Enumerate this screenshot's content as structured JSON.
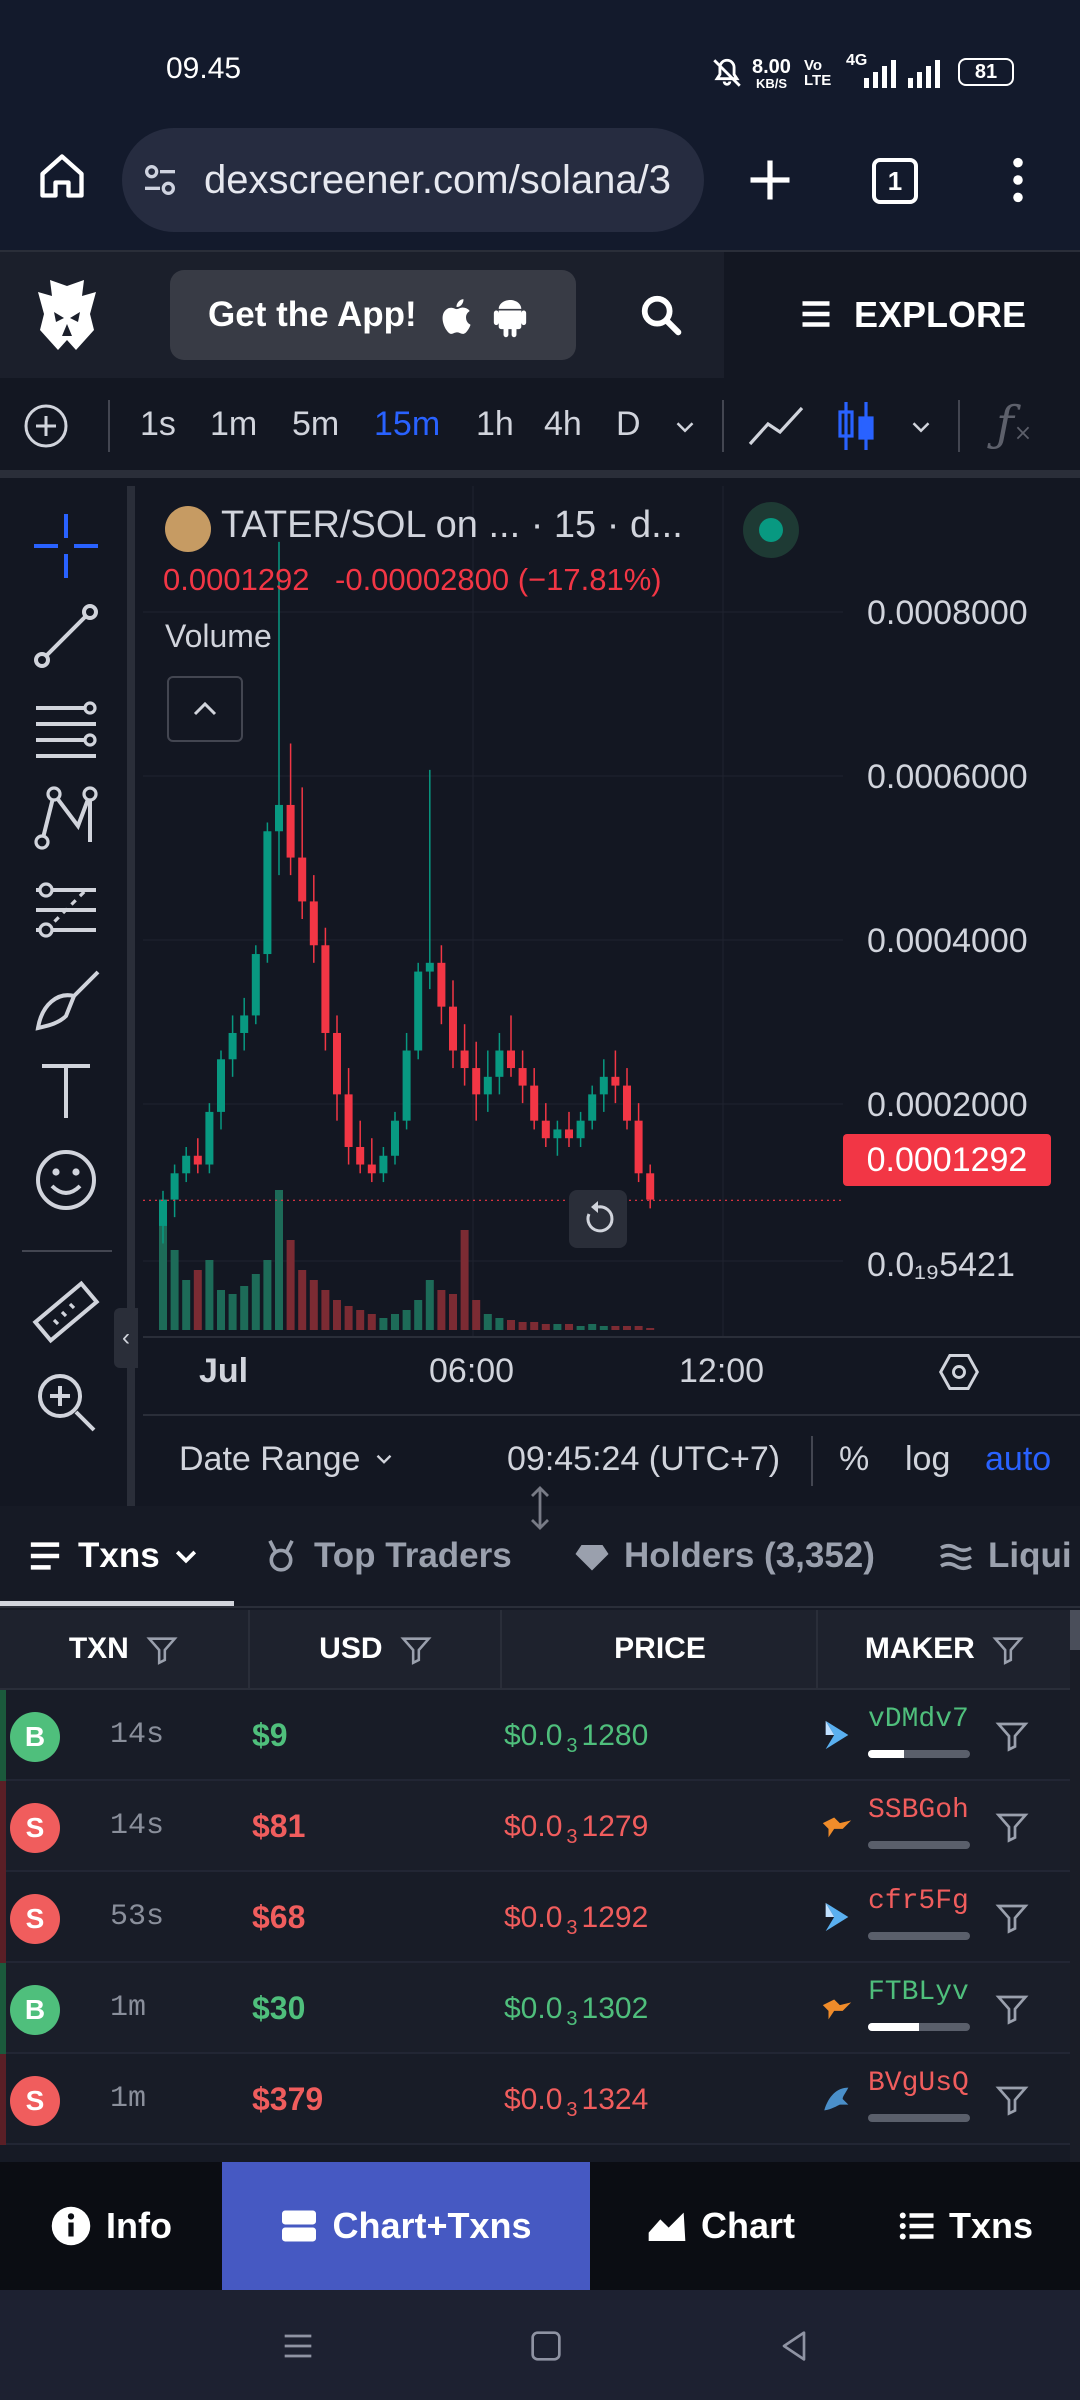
{
  "status_bar": {
    "time": "09.45",
    "net_speed": "8.00",
    "net_unit": "KB/S",
    "volte": "Vo LTE",
    "network": "4G",
    "battery": "81"
  },
  "browser": {
    "url": "dexscreener.com/solana/3",
    "tab_count": "1"
  },
  "app_header": {
    "get_app_label": "Get the App!",
    "explore_label": "EXPLORE"
  },
  "chart_toolbar": {
    "timeframes": [
      "1s",
      "1m",
      "5m",
      "15m",
      "1h",
      "4h",
      "D"
    ],
    "active_timeframe": "15m"
  },
  "chart_legend": {
    "symbol": "TATER/SOL on ... · 15 · d...",
    "last": "0.0001292",
    "change": "-0.00002800 (−17.81%)",
    "volume_label": "Volume"
  },
  "chart_data": {
    "type": "candlestick",
    "title": "TATER/SOL on ... · 15 · d...",
    "price_axis_ticks": [
      "0.0008000",
      "0.0006000",
      "0.0004000",
      "0.0002000",
      "0.0₁₉5421"
    ],
    "time_axis_ticks": [
      "Jul",
      "06:00",
      "12:00"
    ],
    "last_price_label": "0.0001292",
    "ylim": [
      0.0,
      0.0009
    ],
    "candles": [
      {
        "o": 0.0001,
        "h": 0.00014,
        "l": 8e-05,
        "c": 0.00013,
        "v": 0.55
      },
      {
        "o": 0.00013,
        "h": 0.00017,
        "l": 0.00011,
        "c": 0.00016,
        "v": 0.4
      },
      {
        "o": 0.00016,
        "h": 0.00019,
        "l": 0.00015,
        "c": 0.00018,
        "v": 0.25
      },
      {
        "o": 0.00018,
        "h": 0.0002,
        "l": 0.00016,
        "c": 0.00017,
        "v": 0.3
      },
      {
        "o": 0.00017,
        "h": 0.00024,
        "l": 0.00016,
        "c": 0.00023,
        "v": 0.35
      },
      {
        "o": 0.00023,
        "h": 0.0003,
        "l": 0.00021,
        "c": 0.00029,
        "v": 0.2
      },
      {
        "o": 0.00029,
        "h": 0.00034,
        "l": 0.00027,
        "c": 0.00032,
        "v": 0.18
      },
      {
        "o": 0.00032,
        "h": 0.00036,
        "l": 0.0003,
        "c": 0.00034,
        "v": 0.22
      },
      {
        "o": 0.00034,
        "h": 0.00042,
        "l": 0.00033,
        "c": 0.00041,
        "v": 0.28
      },
      {
        "o": 0.00041,
        "h": 0.00056,
        "l": 0.0004,
        "c": 0.00055,
        "v": 0.35
      },
      {
        "o": 0.00055,
        "h": 0.00088,
        "l": 0.0005,
        "c": 0.00058,
        "v": 0.7
      },
      {
        "o": 0.00058,
        "h": 0.00065,
        "l": 0.0005,
        "c": 0.00052,
        "v": 0.45
      },
      {
        "o": 0.00052,
        "h": 0.0006,
        "l": 0.00045,
        "c": 0.00047,
        "v": 0.3
      },
      {
        "o": 0.00047,
        "h": 0.0005,
        "l": 0.0004,
        "c": 0.00042,
        "v": 0.25
      },
      {
        "o": 0.00042,
        "h": 0.00044,
        "l": 0.0003,
        "c": 0.00032,
        "v": 0.2
      },
      {
        "o": 0.00032,
        "h": 0.00034,
        "l": 0.00022,
        "c": 0.00025,
        "v": 0.15
      },
      {
        "o": 0.00025,
        "h": 0.00028,
        "l": 0.00017,
        "c": 0.00019,
        "v": 0.12
      },
      {
        "o": 0.00019,
        "h": 0.00022,
        "l": 0.00016,
        "c": 0.00017,
        "v": 0.1
      },
      {
        "o": 0.00017,
        "h": 0.0002,
        "l": 0.00015,
        "c": 0.00016,
        "v": 0.08
      },
      {
        "o": 0.00016,
        "h": 0.00019,
        "l": 0.00015,
        "c": 0.00018,
        "v": 0.06
      },
      {
        "o": 0.00018,
        "h": 0.00023,
        "l": 0.00017,
        "c": 0.00022,
        "v": 0.08
      },
      {
        "o": 0.00022,
        "h": 0.00032,
        "l": 0.00021,
        "c": 0.0003,
        "v": 0.1
      },
      {
        "o": 0.0003,
        "h": 0.0004,
        "l": 0.00029,
        "c": 0.00039,
        "v": 0.15
      },
      {
        "o": 0.00039,
        "h": 0.00062,
        "l": 0.00037,
        "c": 0.0004,
        "v": 0.25
      },
      {
        "o": 0.0004,
        "h": 0.00042,
        "l": 0.00033,
        "c": 0.00035,
        "v": 0.2
      },
      {
        "o": 0.00035,
        "h": 0.00038,
        "l": 0.00028,
        "c": 0.0003,
        "v": 0.18
      },
      {
        "o": 0.0003,
        "h": 0.00033,
        "l": 0.00026,
        "c": 0.00028,
        "v": 0.5
      },
      {
        "o": 0.00028,
        "h": 0.00031,
        "l": 0.00022,
        "c": 0.00025,
        "v": 0.15
      },
      {
        "o": 0.00025,
        "h": 0.0003,
        "l": 0.00023,
        "c": 0.00027,
        "v": 0.08
      },
      {
        "o": 0.00027,
        "h": 0.00032,
        "l": 0.00025,
        "c": 0.0003,
        "v": 0.06
      },
      {
        "o": 0.0003,
        "h": 0.00034,
        "l": 0.00027,
        "c": 0.00028,
        "v": 0.05
      },
      {
        "o": 0.00028,
        "h": 0.0003,
        "l": 0.00024,
        "c": 0.00026,
        "v": 0.04
      },
      {
        "o": 0.00026,
        "h": 0.00028,
        "l": 0.00021,
        "c": 0.00022,
        "v": 0.04
      },
      {
        "o": 0.00022,
        "h": 0.00024,
        "l": 0.00019,
        "c": 0.0002,
        "v": 0.03
      },
      {
        "o": 0.0002,
        "h": 0.00022,
        "l": 0.00018,
        "c": 0.00021,
        "v": 0.03
      },
      {
        "o": 0.00021,
        "h": 0.00023,
        "l": 0.00019,
        "c": 0.0002,
        "v": 0.03
      },
      {
        "o": 0.0002,
        "h": 0.00023,
        "l": 0.00019,
        "c": 0.00022,
        "v": 0.02
      },
      {
        "o": 0.00022,
        "h": 0.00026,
        "l": 0.00021,
        "c": 0.00025,
        "v": 0.03
      },
      {
        "o": 0.00025,
        "h": 0.00029,
        "l": 0.00023,
        "c": 0.00027,
        "v": 0.02
      },
      {
        "o": 0.00027,
        "h": 0.0003,
        "l": 0.00024,
        "c": 0.00026,
        "v": 0.02
      },
      {
        "o": 0.00026,
        "h": 0.00028,
        "l": 0.00021,
        "c": 0.00022,
        "v": 0.02
      },
      {
        "o": 0.00022,
        "h": 0.00024,
        "l": 0.00015,
        "c": 0.00016,
        "v": 0.02
      },
      {
        "o": 0.00016,
        "h": 0.00017,
        "l": 0.00012,
        "c": 0.00013,
        "v": 0.01
      }
    ]
  },
  "chart_footer": {
    "date_range": "Date Range",
    "time": "09:45:24 (UTC+7)",
    "percent": "%",
    "log": "log",
    "auto": "auto"
  },
  "tabs": {
    "txns": "Txns",
    "top_traders": "Top Traders",
    "holders": "Holders (3,352)",
    "liquidity": "Liqui"
  },
  "table": {
    "headers": {
      "txn": "TXN",
      "usd": "USD",
      "price": "PRICE",
      "maker": "MAKER"
    },
    "rows": [
      {
        "type": "B",
        "age": "14s",
        "usd": "$9",
        "price_prefix": "$0.0",
        "price_sub": "3",
        "price_rest": "1280",
        "maker": "vDMdv7",
        "maker_fill": 0.35,
        "side": "buy",
        "maker_icon": "raydium-icon"
      },
      {
        "type": "S",
        "age": "14s",
        "usd": "$81",
        "price_prefix": "$0.0",
        "price_sub": "3",
        "price_rest": "1279",
        "maker": "SSBGoh",
        "maker_fill": 0.0,
        "side": "sell",
        "maker_icon": "bird-icon"
      },
      {
        "type": "S",
        "age": "53s",
        "usd": "$68",
        "price_prefix": "$0.0",
        "price_sub": "3",
        "price_rest": "1292",
        "maker": "cfr5Fg",
        "maker_fill": 0.0,
        "side": "sell",
        "maker_icon": "raydium-icon"
      },
      {
        "type": "B",
        "age": "1m",
        "usd": "$30",
        "price_prefix": "$0.0",
        "price_sub": "3",
        "price_rest": "1302",
        "maker": "FTBLyv",
        "maker_fill": 0.5,
        "side": "buy",
        "maker_icon": "bird-icon"
      },
      {
        "type": "S",
        "age": "1m",
        "usd": "$379",
        "price_prefix": "$0.0",
        "price_sub": "3",
        "price_rest": "1324",
        "maker": "BVgUsQ",
        "maker_fill": 0.0,
        "side": "sell",
        "maker_icon": "dolphin-icon"
      }
    ]
  },
  "bottom_nav": {
    "info": "Info",
    "chart_txns": "Chart+Txns",
    "chart": "Chart",
    "txns": "Txns"
  },
  "colors": {
    "buy": "#4fbf7c",
    "sell": "#f05d5d",
    "accent": "#2962ff",
    "nav_active": "#4659c2"
  }
}
